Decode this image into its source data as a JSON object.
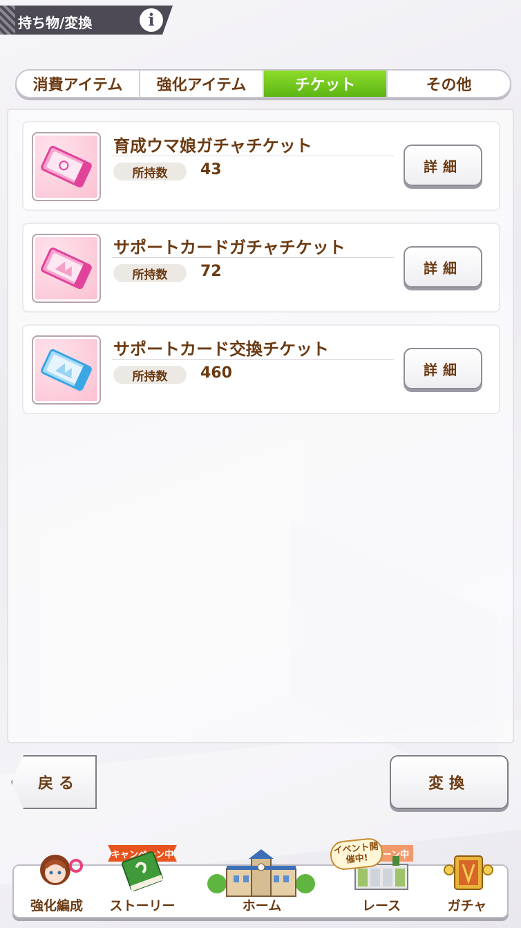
{
  "header": {
    "title": "持ち物/変換",
    "info_label": "i"
  },
  "tabs": [
    {
      "label": "消費アイテム",
      "active": false
    },
    {
      "label": "強化アイテム",
      "active": false
    },
    {
      "label": "チケット",
      "active": true
    },
    {
      "label": "その他",
      "active": false
    }
  ],
  "items": [
    {
      "name": "育成ウマ娘ガチャチケット",
      "count_label": "所持数",
      "count": "43",
      "detail_label": "詳細",
      "icon": "pink-ticket-icon",
      "accent": "#ec4aa7"
    },
    {
      "name": "サポートカードガチャチケット",
      "count_label": "所持数",
      "count": "72",
      "detail_label": "詳細",
      "icon": "pink-ticket-icon",
      "accent": "#ec4aa7"
    },
    {
      "name": "サポートカード交換チケット",
      "count_label": "所持数",
      "count": "460",
      "detail_label": "詳細",
      "icon": "blue-ticket-icon",
      "accent": "#45aee8"
    }
  ],
  "actions": {
    "back_label": "戻る",
    "convert_label": "変換"
  },
  "nav": {
    "items": [
      {
        "label": "強化編成",
        "icon": "character-icon"
      },
      {
        "label": "ストーリー",
        "icon": "book-icon"
      },
      {
        "label": "ホーム",
        "icon": "school-building-icon"
      },
      {
        "label": "レース",
        "icon": "race-gate-icon"
      },
      {
        "label": "ガチャ",
        "icon": "gacha-box-icon"
      }
    ],
    "story_ribbon": "キャンペーン中",
    "race_ribbon": "ーン中",
    "event_badge": "イベント開催中!"
  },
  "colors": {
    "active_tab": "#6fc51b",
    "text_brown": "#6b3a12",
    "header_bg": "#4d4a55"
  }
}
